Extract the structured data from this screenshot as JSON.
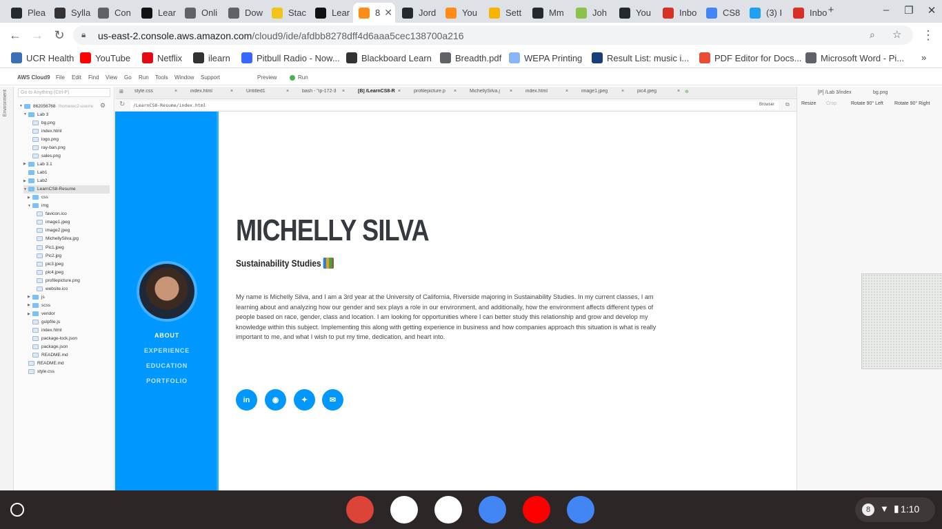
{
  "browser": {
    "tabs": [
      {
        "label": "Plea",
        "icon": "github-icon",
        "color": "#24292e"
      },
      {
        "label": "Sylla",
        "icon": "blackboard-icon",
        "color": "#333333"
      },
      {
        "label": "Con",
        "icon": "globe-icon",
        "color": "#5f6368"
      },
      {
        "label": "Lear",
        "icon": "zybooks-icon",
        "color": "#111111"
      },
      {
        "label": "Onli",
        "icon": "globe-icon",
        "color": "#5f6368"
      },
      {
        "label": "Dow",
        "icon": "globe-icon",
        "color": "#5f6368"
      },
      {
        "label": "Stac",
        "icon": "stackedit-icon",
        "color": "#f0c419"
      },
      {
        "label": "Lear",
        "icon": "zybooks-icon",
        "color": "#111111"
      },
      {
        "label": "8",
        "icon": "aws-cloud9-icon",
        "color": "#ff8c1a"
      },
      {
        "label": "Jord",
        "icon": "github-icon",
        "color": "#24292e"
      },
      {
        "label": "You",
        "icon": "aws-cloud9-icon",
        "color": "#ff8c1a"
      },
      {
        "label": "Sett",
        "icon": "settings-doc-icon",
        "color": "#f4b400"
      },
      {
        "label": "Mm",
        "icon": "github-icon",
        "color": "#24292e"
      },
      {
        "label": "Joh",
        "icon": "avocado-icon",
        "color": "#8bc34a"
      },
      {
        "label": "You",
        "icon": "github-icon",
        "color": "#24292e"
      },
      {
        "label": "Inbo",
        "icon": "gmail-icon",
        "color": "#d93025"
      },
      {
        "label": "CS8",
        "icon": "google-docs-icon",
        "color": "#4285f4"
      },
      {
        "label": "(3) I",
        "icon": "twitter-icon",
        "color": "#1da1f2"
      },
      {
        "label": "Inbo",
        "icon": "gmail-icon",
        "color": "#d93025"
      }
    ],
    "new_tab": "+",
    "url_host": "us-east-2.console.aws.amazon.com",
    "url_path": "/cloud9/ide/afdbb8278dff4d6aaa5cec138700a216",
    "bookmarks": [
      {
        "label": "UCR Health",
        "icon": "globe-icon",
        "color": "#3b6fb6"
      },
      {
        "label": "YouTube",
        "icon": "youtube-icon",
        "color": "#ff0000"
      },
      {
        "label": "Netflix",
        "icon": "netflix-icon",
        "color": "#e50914"
      },
      {
        "label": "ilearn",
        "icon": "blackboard-icon",
        "color": "#333333"
      },
      {
        "label": "Pitbull Radio - Now...",
        "icon": "pandora-icon",
        "color": "#3668ff"
      },
      {
        "label": "Blackboard Learn",
        "icon": "blackboard-icon",
        "color": "#333333"
      },
      {
        "label": "Breadth.pdf",
        "icon": "globe-icon",
        "color": "#5f6368"
      },
      {
        "label": "WEPA Printing",
        "icon": "wepa-icon",
        "color": "#8ab4f8"
      },
      {
        "label": "Result List: music i...",
        "icon": "ebsco-icon",
        "color": "#1a3e7a"
      },
      {
        "label": "PDF Editor for Docs...",
        "icon": "pdf-editor-icon",
        "color": "#e94b35"
      },
      {
        "label": "Microsoft Word - Pi...",
        "icon": "globe-icon",
        "color": "#5f6368"
      }
    ]
  },
  "cloud9": {
    "menu": [
      "AWS Cloud9",
      "File",
      "Edit",
      "Find",
      "View",
      "Go",
      "Run",
      "Tools",
      "Window",
      "Support"
    ],
    "preview": "Preview",
    "run": "Run",
    "gutter_label": "Environment",
    "goto_placeholder": "Go to Anything (Ctrl-P)",
    "tree": [
      {
        "label": "862056768",
        "suffix": " - /home/ec2-user/e",
        "type": "folder",
        "depth": 0,
        "arrow": "▼"
      },
      {
        "label": "Lab 3",
        "type": "folder",
        "depth": 1,
        "arrow": "▼"
      },
      {
        "label": "bg.png",
        "type": "file",
        "depth": 2
      },
      {
        "label": "index.html",
        "type": "file",
        "depth": 2
      },
      {
        "label": "logo.png",
        "type": "file",
        "depth": 2
      },
      {
        "label": "ray-ban.png",
        "type": "file",
        "depth": 2
      },
      {
        "label": "sales.png",
        "type": "file",
        "depth": 2
      },
      {
        "label": "Lab 3.1",
        "type": "folder",
        "depth": 1,
        "arrow": "▶"
      },
      {
        "label": "Lab1",
        "type": "folder",
        "depth": 1
      },
      {
        "label": "Lab2",
        "type": "folder",
        "depth": 1,
        "arrow": "▶"
      },
      {
        "label": "LearnCS8-Resume",
        "type": "folder",
        "depth": 1,
        "arrow": "▼",
        "selected": true
      },
      {
        "label": "css",
        "type": "folder",
        "depth": 2,
        "arrow": "▶"
      },
      {
        "label": "img",
        "type": "folder",
        "depth": 2,
        "arrow": "▼"
      },
      {
        "label": "favicon.ico",
        "type": "file",
        "depth": 3
      },
      {
        "label": "image1.jpeg",
        "type": "file",
        "depth": 3
      },
      {
        "label": "image2.jpeg",
        "type": "file",
        "depth": 3
      },
      {
        "label": "MichellySilva.jpg",
        "type": "file",
        "depth": 3
      },
      {
        "label": "Pic1.jpeg",
        "type": "file",
        "depth": 3
      },
      {
        "label": "Pic2.jpg",
        "type": "file",
        "depth": 3
      },
      {
        "label": "pic3.jpeg",
        "type": "file",
        "depth": 3
      },
      {
        "label": "pic4.jpeg",
        "type": "file",
        "depth": 3
      },
      {
        "label": "profilepicture.png",
        "type": "file",
        "depth": 3
      },
      {
        "label": "website.ico",
        "type": "file",
        "depth": 3
      },
      {
        "label": "js",
        "type": "folder",
        "depth": 2,
        "arrow": "▶"
      },
      {
        "label": "scss",
        "type": "folder",
        "depth": 2,
        "arrow": "▶"
      },
      {
        "label": "vendor",
        "type": "folder",
        "depth": 2,
        "arrow": "▶"
      },
      {
        "label": "gulpfile.js",
        "type": "file",
        "depth": 2
      },
      {
        "label": "index.html",
        "type": "file",
        "depth": 2
      },
      {
        "label": "package-lock.json",
        "type": "file",
        "depth": 2
      },
      {
        "label": "package.json",
        "type": "file",
        "depth": 2
      },
      {
        "label": "README.md",
        "type": "file",
        "depth": 2
      },
      {
        "label": "README.md",
        "type": "file",
        "depth": 1
      },
      {
        "label": "style.css",
        "type": "file",
        "depth": 1
      }
    ],
    "editor_tabs": [
      "style.css",
      "index.html",
      "Untitled1",
      "bash - \"ip-172-3",
      "[B] /LearnCS8-R",
      "profilepicture.p",
      "MichellySilva.j",
      "index.html",
      "image1.jpeg",
      "pic4.jpeg"
    ],
    "preview_path": "/LearnCS8-Resume/index.html",
    "browser_label": "Browser",
    "right_tabs": [
      "[P] /Lab 3/index",
      "bg.png"
    ],
    "right_buttons": [
      "Resize",
      "Crop",
      "Rotate 90° Left",
      "Rotate 90° Right"
    ]
  },
  "resume": {
    "name": "MICHELLY SILVA",
    "subtitle": "Sustainability Studies",
    "nav": [
      "ABOUT",
      "EXPERIENCE",
      "EDUCATION",
      "PORTFOLIO"
    ],
    "bio": "My name is Michelly Silva, and I am a 3rd year at the University of California, Riverside majoring in Sustainability Studies. In my current classes, I am learning about and analyzing how our gender and sex plays a role in our environment, and additionally, how the environment affects different types of people based on race, gender, class and location. I am looking for opportunities where I can better study this relationship and grow and develop my knowledge within this subject. Implementing this along with getting experience in business and how companies approach this situation is what is really important to me, and what I wish to put my time, dedication, and heart into.",
    "social": [
      {
        "icon": "linkedin-icon",
        "glyph": "in"
      },
      {
        "icon": "github-icon",
        "glyph": "◉"
      },
      {
        "icon": "twitter-icon",
        "glyph": "✦"
      },
      {
        "icon": "email-icon",
        "glyph": "✉"
      }
    ],
    "accent": "#0098ff"
  },
  "shelf": {
    "apps": [
      {
        "icon": "chrome-icon",
        "color": "#db4437"
      },
      {
        "icon": "play-store-icon",
        "color": "#ffffff"
      },
      {
        "icon": "gmail-icon",
        "color": "#ffffff"
      },
      {
        "icon": "google-docs-icon",
        "color": "#4285f4"
      },
      {
        "icon": "youtube-icon",
        "color": "#ff0000"
      },
      {
        "icon": "files-icon",
        "color": "#4285f4"
      }
    ],
    "notification_count": "8",
    "time": "1:10"
  }
}
